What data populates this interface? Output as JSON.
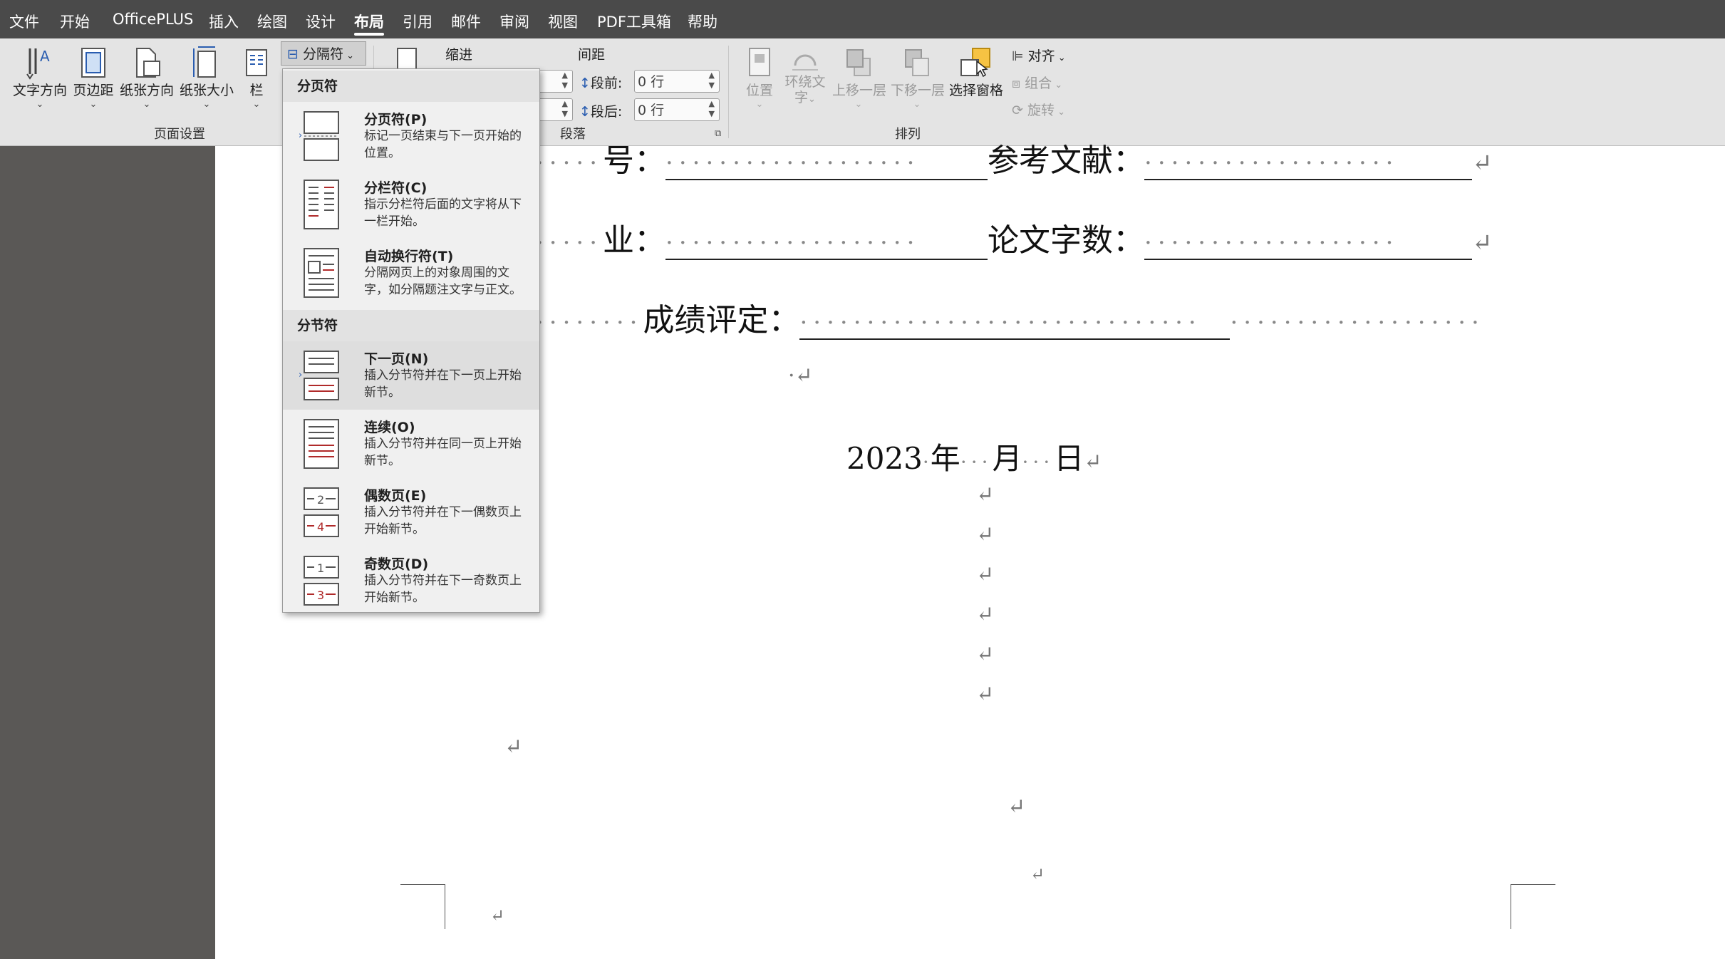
{
  "menu": {
    "items": [
      "文件",
      "开始",
      "OfficePLUS",
      "插入",
      "绘图",
      "设计",
      "布局",
      "引用",
      "邮件",
      "审阅",
      "视图",
      "PDF工具箱",
      "帮助"
    ],
    "active": "布局"
  },
  "ribbon": {
    "page_setup": {
      "label": "页面设置",
      "text_direction": "文字方向",
      "margins": "页边距",
      "orientation": "纸张方向",
      "size": "纸张大小",
      "columns": "栏",
      "breaks": "分隔符"
    },
    "paragraph": {
      "label": "段落",
      "indent": "缩进",
      "spacing": "间距",
      "before_label": "段前:",
      "before_value": "0 行",
      "after_label": "段后:",
      "after_value": "0 行"
    },
    "arrange": {
      "label": "排列",
      "position": "位置",
      "wrap_text_1": "环绕文",
      "wrap_text_2": "字",
      "bring_forward": "上移一层",
      "send_backward": "下移一层",
      "selection_pane": "选择窗格",
      "align": "对齐",
      "group": "组合",
      "rotate": "旋转"
    }
  },
  "dropdown": {
    "page_breaks_header": "分页符",
    "section_breaks_header": "分节符",
    "items": [
      {
        "title": "分页符(P)",
        "desc": "标记一页结束与下一页开始的位置。"
      },
      {
        "title": "分栏符(C)",
        "desc": "指示分栏符后面的文字将从下一栏开始。"
      },
      {
        "title": "自动换行符(T)",
        "desc": "分隔网页上的对象周围的文字，如分隔题注文字与正文。"
      },
      {
        "title": "下一页(N)",
        "desc": "插入分节符并在下一页上开始新节。"
      },
      {
        "title": "连续(O)",
        "desc": "插入分节符并在同一页上开始新节。"
      },
      {
        "title": "偶数页(E)",
        "desc": "插入分节符并在下一偶数页上开始新节。"
      },
      {
        "title": "奇数页(D)",
        "desc": "插入分节符并在下一奇数页上开始新节。"
      }
    ]
  },
  "document": {
    "line1_a": "号：",
    "line1_b": "参考文献：",
    "line2_a": "业：",
    "line2_b": "论文字数：",
    "line3": "成绩评定：",
    "date_year": "2023",
    "date_y": "年",
    "date_m": "月",
    "date_d": "日",
    "para_mark": "↵"
  }
}
